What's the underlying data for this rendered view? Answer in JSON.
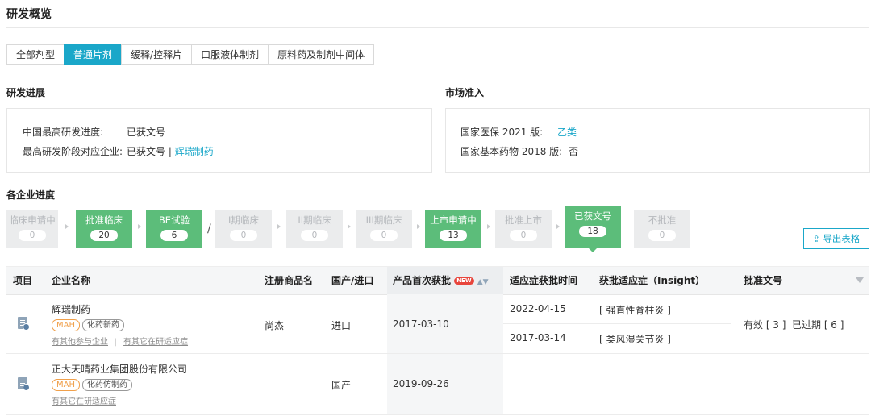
{
  "page_title": "研发概览",
  "tabs": [
    {
      "label": "全部剂型",
      "active": false
    },
    {
      "label": "普通片剂",
      "active": true
    },
    {
      "label": "缓释/控释片",
      "active": false
    },
    {
      "label": "口服液体制剂",
      "active": false
    },
    {
      "label": "原料药及制剂中间体",
      "active": false
    }
  ],
  "rd_progress": {
    "title": "研发进展",
    "china_highest_label": "中国最高研发进度:",
    "china_highest_value": "已获文号",
    "highest_stage_company_label": "最高研发阶段对应企业:",
    "highest_stage_company_value": "已获文号 |",
    "highest_stage_company_link": "辉瑞制药"
  },
  "market_access": {
    "title": "市场准入",
    "nrdl_label": "国家医保 2021 版:",
    "nrdl_value": "乙类",
    "edl_label": "国家基本药物 2018 版:",
    "edl_value": "否"
  },
  "company_progress": {
    "title": "各企业进度",
    "stages": [
      {
        "name": "临床申请中",
        "count": "0",
        "status": "grey"
      },
      {
        "name": "批准临床",
        "count": "20",
        "status": "green"
      },
      {
        "name": "BE试验",
        "count": "6",
        "status": "green"
      },
      {
        "name": "I期临床",
        "count": "0",
        "status": "grey"
      },
      {
        "name": "II期临床",
        "count": "0",
        "status": "grey"
      },
      {
        "name": "III期临床",
        "count": "0",
        "status": "grey"
      },
      {
        "name": "上市申请中",
        "count": "13",
        "status": "green"
      },
      {
        "name": "批准上市",
        "count": "0",
        "status": "grey"
      },
      {
        "name": "已获文号",
        "count": "18",
        "status": "green"
      },
      {
        "name": "不批准",
        "count": "0",
        "status": "grey"
      }
    ],
    "separator": "/",
    "export_label": "导出表格"
  },
  "table": {
    "headers": {
      "item": "项目",
      "company": "企业名称",
      "brand": "注册商品名",
      "origin": "国产/进口",
      "first_approval": "产品首次获批",
      "new_badge": "NEW",
      "indication_time": "适应症获批时间",
      "indication": "获批适应症（Insight）",
      "approval_no": "批准文号"
    },
    "rows": [
      {
        "company": "辉瑞制药",
        "tags": [
          "MAH",
          "化药新药"
        ],
        "notes": [
          "有其他参与企业",
          "有其它在研适应症"
        ],
        "brand": "尚杰",
        "origin": "进口",
        "first_approval": "2017-03-10",
        "indications": [
          {
            "date": "2022-04-15",
            "name": "[ 强直性脊柱炎 ]"
          },
          {
            "date": "2017-03-14",
            "name": "[ 类风湿关节炎 ]"
          }
        ],
        "approval_valid": "有效 [ 3 ]",
        "approval_expired": "已过期 [ 6 ]"
      },
      {
        "company": "正大天晴药业集团股份有限公司",
        "tags": [
          "MAH",
          "化药仿制药"
        ],
        "notes": [
          "有其它在研适应症"
        ],
        "brand": "",
        "origin": "国产",
        "first_approval": "2019-09-26"
      }
    ]
  },
  "colors": {
    "accent": "#1aa7c9",
    "stage_green": "#5cbd7a",
    "stage_grey": "#ebeced",
    "mah_orange": "#f0a04b",
    "new_red": "#e8453c"
  }
}
